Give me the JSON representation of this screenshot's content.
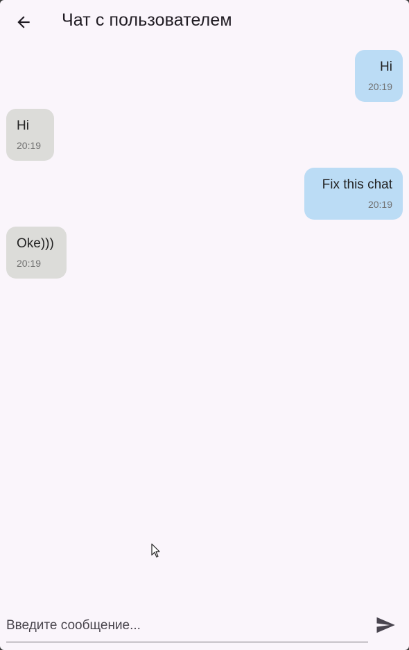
{
  "appbar": {
    "title": "Чат с пользователем",
    "back_icon": "arrow-left-icon"
  },
  "messages": [
    {
      "direction": "outgoing",
      "text": "Hi",
      "time": "20:19"
    },
    {
      "direction": "incoming",
      "text": "Hi",
      "time": "20:19"
    },
    {
      "direction": "outgoing",
      "text": "Fix this chat",
      "time": "20:19"
    },
    {
      "direction": "incoming",
      "text": "Oke)))",
      "time": "20:19"
    }
  ],
  "composer": {
    "placeholder": "Введите сообщение...",
    "value": "",
    "send_icon": "send-icon"
  },
  "colors": {
    "background": "#faf5fb",
    "outgoing_bubble": "#bbdcf5",
    "incoming_bubble": "#dcdcd9"
  }
}
